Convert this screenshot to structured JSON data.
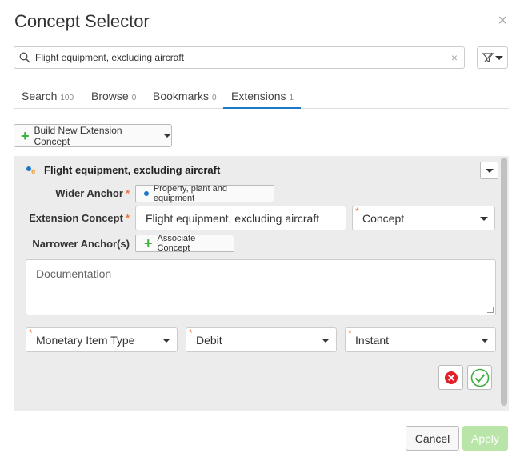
{
  "dialog": {
    "title": "Concept Selector",
    "close_glyph": "×"
  },
  "search": {
    "value": "Flight equipment, excluding aircraft",
    "clear_glyph": "×",
    "icon": "search-icon"
  },
  "filter": {
    "icon": "filter-icon"
  },
  "tabs": [
    {
      "label": "Search",
      "count": "100"
    },
    {
      "label": "Browse",
      "count": "0"
    },
    {
      "label": "Bookmarks",
      "count": "0"
    },
    {
      "label": "Extensions",
      "count": "1",
      "active": true
    }
  ],
  "toolbar": {
    "build_label": "Build New Extension Concept"
  },
  "concept": {
    "heading": "Flight equipment, excluding aircraft",
    "wider_anchor_label": "Wider Anchor",
    "wider_anchor_value": "Property, plant and equipment",
    "extension_label": "Extension Concept",
    "extension_value": "Flight equipment, excluding aircraft",
    "concept_type": "Concept",
    "narrower_label": "Narrower Anchor(s)",
    "associate_label": "Associate Concept",
    "documentation_placeholder": "Documentation",
    "item_type": "Monetary Item Type",
    "balance": "Debit",
    "period": "Instant",
    "required_mark": "*"
  },
  "footer": {
    "cancel_label": "Cancel",
    "apply_label": "Apply"
  },
  "colors": {
    "accent": "#1b78c8",
    "required": "#e8763a",
    "apply": "#b9e5a8",
    "add": "#3cb03c",
    "delete": "#e0202a"
  }
}
